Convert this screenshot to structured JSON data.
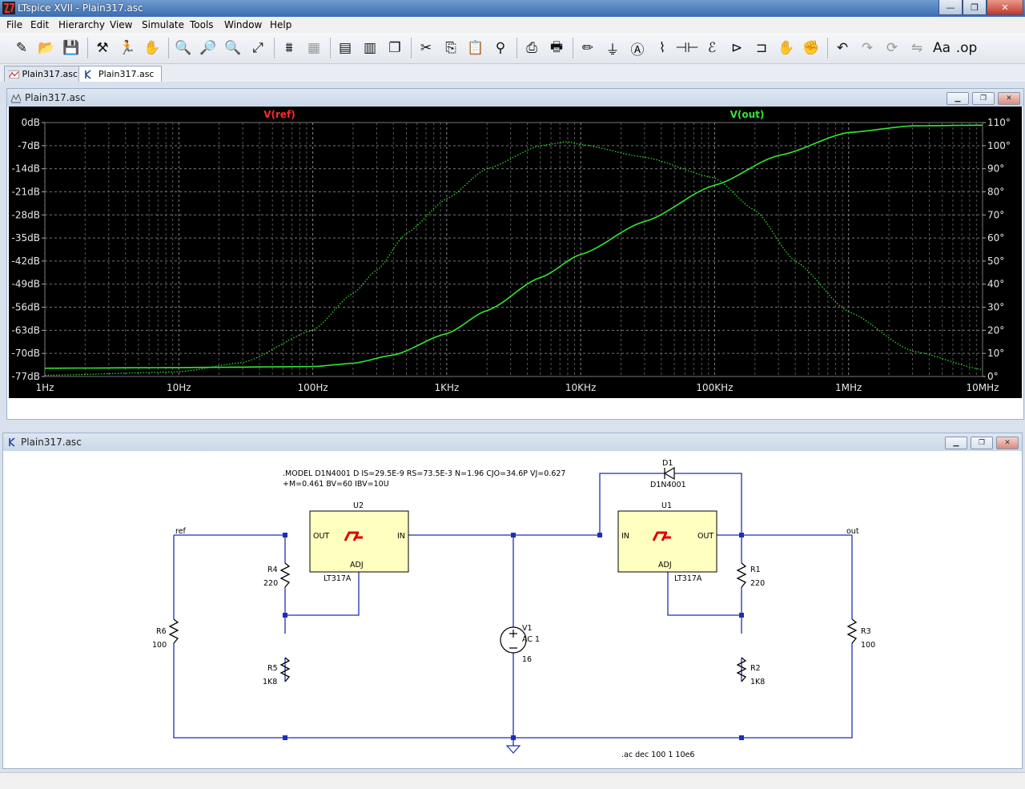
{
  "window": {
    "title": "LTspice XVII - Plain317.asc",
    "min": "—",
    "max": "❐",
    "close": "✕"
  },
  "menu": [
    "File",
    "Edit",
    "Hierarchy",
    "View",
    "Simulate",
    "Tools",
    "Window",
    "Help"
  ],
  "toolbar": [
    {
      "name": "new-schematic",
      "glyph": "✎"
    },
    {
      "name": "open",
      "glyph": "📂"
    },
    {
      "name": "save",
      "glyph": "💾"
    },
    {
      "name": "control-panel",
      "glyph": "⚒"
    },
    {
      "name": "run",
      "glyph": "🏃"
    },
    {
      "name": "halt",
      "glyph": "✋",
      "dim": true
    },
    {
      "name": "zoom-in",
      "glyph": "🔍"
    },
    {
      "name": "zoom-pan",
      "glyph": "🔎",
      "dim": true
    },
    {
      "name": "zoom-out",
      "glyph": "🔍"
    },
    {
      "name": "zoom-fit",
      "glyph": "⤢"
    },
    {
      "name": "autorange",
      "glyph": "⩩"
    },
    {
      "name": "grid",
      "glyph": "▦",
      "dim": true
    },
    {
      "name": "tile-horizontal",
      "glyph": "▤"
    },
    {
      "name": "tile-vertical",
      "glyph": "▥"
    },
    {
      "name": "cascade",
      "glyph": "❐"
    },
    {
      "name": "cut",
      "glyph": "✂"
    },
    {
      "name": "copy",
      "glyph": "⎘"
    },
    {
      "name": "paste",
      "glyph": "📋"
    },
    {
      "name": "find",
      "glyph": "⚲"
    },
    {
      "name": "print-setup",
      "glyph": "⎙"
    },
    {
      "name": "print",
      "glyph": "🖶"
    },
    {
      "name": "draw-wire",
      "glyph": "✏"
    },
    {
      "name": "ground",
      "glyph": "⏚"
    },
    {
      "name": "label-net",
      "glyph": "Ⓐ"
    },
    {
      "name": "resistor",
      "glyph": "⌇"
    },
    {
      "name": "capacitor",
      "glyph": "⊣⊢"
    },
    {
      "name": "inductor",
      "glyph": "ℰ"
    },
    {
      "name": "diode",
      "glyph": "⊳"
    },
    {
      "name": "component",
      "glyph": "⊐"
    },
    {
      "name": "move",
      "glyph": "✋"
    },
    {
      "name": "drag",
      "glyph": "✊"
    },
    {
      "name": "undo",
      "glyph": "↶"
    },
    {
      "name": "redo",
      "glyph": "↷",
      "dim": true
    },
    {
      "name": "rotate",
      "glyph": "⟳",
      "dim": true
    },
    {
      "name": "mirror",
      "glyph": "⇋",
      "dim": true
    },
    {
      "name": "text",
      "glyph": "Aa"
    },
    {
      "name": "spice-directive",
      "glyph": ".op"
    }
  ],
  "tabs": [
    {
      "label": "Plain317.asc",
      "kind": "waveform"
    },
    {
      "label": "Plain317.asc",
      "kind": "schematic"
    }
  ],
  "wave_window": {
    "title": "Plain317.asc"
  },
  "sch_window": {
    "title": "Plain317.asc"
  },
  "plot": {
    "traces": [
      {
        "name": "V(ref)",
        "color": "#ff2b2b"
      },
      {
        "name": "V(out)",
        "color": "#33e633"
      }
    ],
    "y_left_ticks": [
      "0dB",
      "-7dB",
      "-14dB",
      "-21dB",
      "-28dB",
      "-35dB",
      "-42dB",
      "-49dB",
      "-56dB",
      "-63dB",
      "-70dB",
      "-77dB"
    ],
    "y_right_ticks": [
      "110°",
      "100°",
      "90°",
      "80°",
      "70°",
      "60°",
      "50°",
      "40°",
      "30°",
      "20°",
      "10°",
      "0°"
    ],
    "x_ticks": [
      "1Hz",
      "10Hz",
      "100Hz",
      "1KHz",
      "10KHz",
      "100KHz",
      "1MHz",
      "10MHz"
    ]
  },
  "chart_data": {
    "type": "line",
    "x_scale": "log",
    "xlim": [
      1,
      10000000
    ],
    "ylim_left_db": [
      -77,
      0
    ],
    "ylim_right_deg": [
      0,
      110
    ],
    "grid": true,
    "series": [
      {
        "name": "V(out)",
        "axis": "left",
        "style": "solid",
        "x": [
          1,
          10,
          100,
          200,
          400,
          1000,
          2000,
          5000,
          10000,
          30000,
          100000,
          300000,
          1000000,
          3000000,
          10000000
        ],
        "y": [
          -74.5,
          -74.3,
          -74.0,
          -73.0,
          -70.5,
          -64,
          -57,
          -47,
          -40,
          -30,
          -19,
          -10,
          -3,
          -1,
          -0.8
        ]
      },
      {
        "name": "V(out)",
        "axis": "right",
        "style": "dotted",
        "x": [
          1,
          10,
          30,
          100,
          200,
          300,
          500,
          1000,
          2000,
          5000,
          8000,
          10000,
          30000,
          100000,
          200000,
          400000,
          1000000,
          3000000,
          10000000
        ],
        "y": [
          0.5,
          2,
          6,
          20,
          36,
          46,
          62,
          77,
          90,
          100,
          101.7,
          100.5,
          95,
          86,
          72,
          50,
          28,
          11,
          3
        ]
      }
    ]
  },
  "schematic": {
    "directive_model_1": ".MODEL D1N4001 D IS=29.5E-9 RS=73.5E-3 N=1.96 CJO=34.6P VJ=0.627",
    "directive_model_2": "+M=0.461 BV=60 IBV=10U",
    "directive_ac": ".ac dec 100 1 10e6",
    "u2": {
      "ref": "U2",
      "part": "LT317A",
      "out": "OUT",
      "in": "IN",
      "adj": "ADJ"
    },
    "u1": {
      "ref": "U1",
      "part": "LT317A",
      "out": "OUT",
      "in": "IN",
      "adj": "ADJ"
    },
    "d1": {
      "ref": "D1",
      "part": "D1N4001"
    },
    "v1": {
      "ref": "V1",
      "ac": "AC 1",
      "dc": "16"
    },
    "r1": {
      "ref": "R1",
      "value": "220"
    },
    "r2": {
      "ref": "R2",
      "value": "1K8"
    },
    "r3": {
      "ref": "R3",
      "value": "100"
    },
    "r4": {
      "ref": "R4",
      "value": "220"
    },
    "r5": {
      "ref": "R5",
      "value": "1K8"
    },
    "r6": {
      "ref": "R6",
      "value": "100"
    },
    "net_ref": "ref",
    "net_out": "out"
  }
}
